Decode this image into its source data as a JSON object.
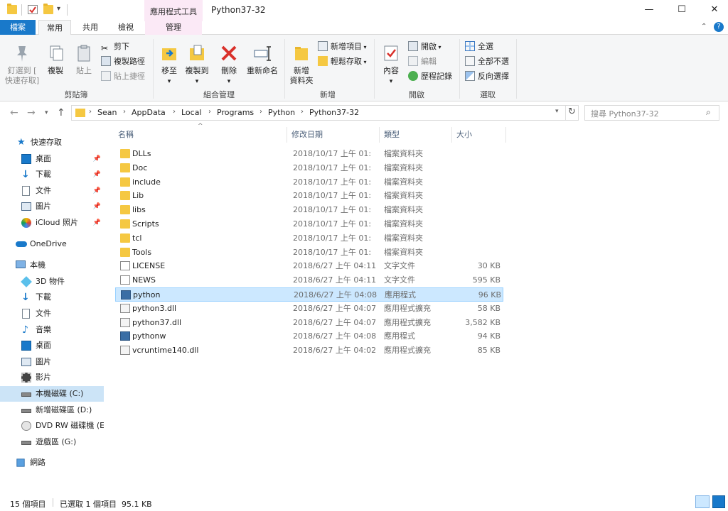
{
  "title_bar": {
    "context_tab_group": "應用程式工具",
    "window_title": "Python37-32",
    "minimize": "—",
    "maximize": "☐",
    "close": "✕"
  },
  "tabs": {
    "file": "檔案",
    "home": "常用",
    "share": "共用",
    "view": "檢視",
    "manage": "管理"
  },
  "ribbon": {
    "clipboard": {
      "pin": "釘選到 [",
      "pin2": "快速存取]",
      "copy": "複製",
      "paste": "貼上",
      "cut": "剪下",
      "copy_path": "複製路徑",
      "paste_shortcut": "貼上捷徑",
      "label": "剪貼簿"
    },
    "organize": {
      "move_to": "移至",
      "copy_to": "複製到",
      "delete": "刪除",
      "rename": "重新命名",
      "label": "組合管理"
    },
    "new": {
      "new_folder": "新增",
      "new_folder2": "資料夾",
      "new_item": "新增項目",
      "easy_access": "輕鬆存取",
      "label": "新增"
    },
    "open": {
      "properties": "內容",
      "open": "開啟",
      "edit": "編輯",
      "history": "歷程記錄",
      "label": "開啟"
    },
    "select": {
      "select_all": "全選",
      "select_none": "全部不選",
      "invert": "反向選擇",
      "label": "選取"
    }
  },
  "address": {
    "crumbs": [
      "Sean",
      "AppData",
      "Local",
      "Programs",
      "Python",
      "Python37-32"
    ],
    "search_placeholder": "搜尋 Python37-32"
  },
  "sidebar": {
    "quick_access": "快速存取",
    "items": [
      {
        "label": "桌面"
      },
      {
        "label": "下載"
      },
      {
        "label": "文件"
      },
      {
        "label": "圖片"
      },
      {
        "label": "iCloud 照片"
      }
    ],
    "onedrive": "OneDrive",
    "this_pc": "本機",
    "pc_items": [
      {
        "label": "3D 物件"
      },
      {
        "label": "下載"
      },
      {
        "label": "文件"
      },
      {
        "label": "音樂"
      },
      {
        "label": "桌面"
      },
      {
        "label": "圖片"
      },
      {
        "label": "影片"
      },
      {
        "label": "本機磁碟 (C:)"
      },
      {
        "label": "新增磁碟區 (D:)"
      },
      {
        "label": "DVD RW 磁碟機 (E"
      },
      {
        "label": "遊戲區 (G:)"
      }
    ],
    "network": "網路"
  },
  "columns": {
    "name": "名稱",
    "date": "修改日期",
    "type": "類型",
    "size": "大小"
  },
  "files": [
    {
      "name": "DLLs",
      "date": "2018/10/17 上午 01:",
      "type": "檔案資料夾",
      "size": "",
      "kind": "folder"
    },
    {
      "name": "Doc",
      "date": "2018/10/17 上午 01:",
      "type": "檔案資料夾",
      "size": "",
      "kind": "folder"
    },
    {
      "name": "include",
      "date": "2018/10/17 上午 01:",
      "type": "檔案資料夾",
      "size": "",
      "kind": "folder"
    },
    {
      "name": "Lib",
      "date": "2018/10/17 上午 01:",
      "type": "檔案資料夾",
      "size": "",
      "kind": "folder"
    },
    {
      "name": "libs",
      "date": "2018/10/17 上午 01:",
      "type": "檔案資料夾",
      "size": "",
      "kind": "folder"
    },
    {
      "name": "Scripts",
      "date": "2018/10/17 上午 01:",
      "type": "檔案資料夾",
      "size": "",
      "kind": "folder"
    },
    {
      "name": "tcl",
      "date": "2018/10/17 上午 01:",
      "type": "檔案資料夾",
      "size": "",
      "kind": "folder"
    },
    {
      "name": "Tools",
      "date": "2018/10/17 上午 01:",
      "type": "檔案資料夾",
      "size": "",
      "kind": "folder"
    },
    {
      "name": "LICENSE",
      "date": "2018/6/27 上午 04:11",
      "type": "文字文件",
      "size": "30 KB",
      "kind": "doc"
    },
    {
      "name": "NEWS",
      "date": "2018/6/27 上午 04:11",
      "type": "文字文件",
      "size": "595 KB",
      "kind": "doc"
    },
    {
      "name": "python",
      "date": "2018/6/27 上午 04:08",
      "type": "應用程式",
      "size": "96 KB",
      "kind": "exe"
    },
    {
      "name": "python3.dll",
      "date": "2018/6/27 上午 04:07",
      "type": "應用程式擴充",
      "size": "58 KB",
      "kind": "dll"
    },
    {
      "name": "python37.dll",
      "date": "2018/6/27 上午 04:07",
      "type": "應用程式擴充",
      "size": "3,582 KB",
      "kind": "dll"
    },
    {
      "name": "pythonw",
      "date": "2018/6/27 上午 04:08",
      "type": "應用程式",
      "size": "94 KB",
      "kind": "exe"
    },
    {
      "name": "vcruntime140.dll",
      "date": "2018/6/27 上午 04:02",
      "type": "應用程式擴充",
      "size": "85 KB",
      "kind": "dll"
    }
  ],
  "status": {
    "count": "15 個項目",
    "selected": "已選取 1 個項目  95.1 KB"
  }
}
